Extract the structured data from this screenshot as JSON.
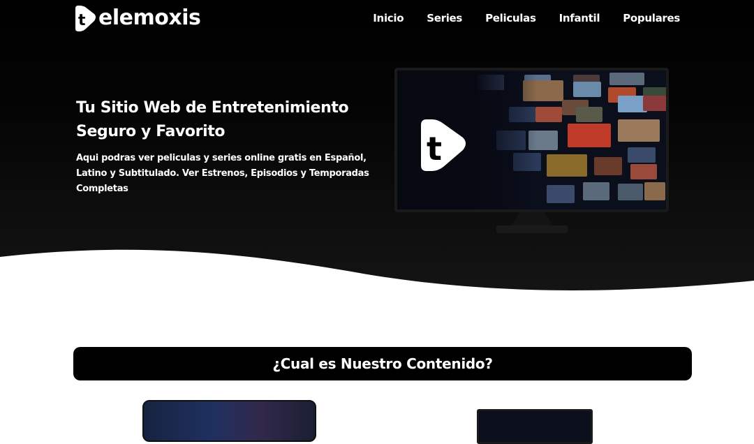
{
  "brand": {
    "name": "elemoxis",
    "badge_letter": "t"
  },
  "nav": {
    "items": [
      {
        "label": "Inicio"
      },
      {
        "label": "Series"
      },
      {
        "label": "Peliculas"
      },
      {
        "label": "Infantil"
      },
      {
        "label": "Populares"
      }
    ]
  },
  "hero": {
    "title": "Tu Sitio Web de Entretenimiento Seguro y Favorito",
    "description": "Aqui podras ver peliculas y series online gratis en Español, Latino y Subtitulado. Ver Estrenos, Episodios y Temporadas Completas"
  },
  "section": {
    "title": "¿Cual es Nuestro Contenido?"
  },
  "colors": {
    "background": "#000000",
    "text": "#ffffff",
    "surface": "#ffffff"
  }
}
